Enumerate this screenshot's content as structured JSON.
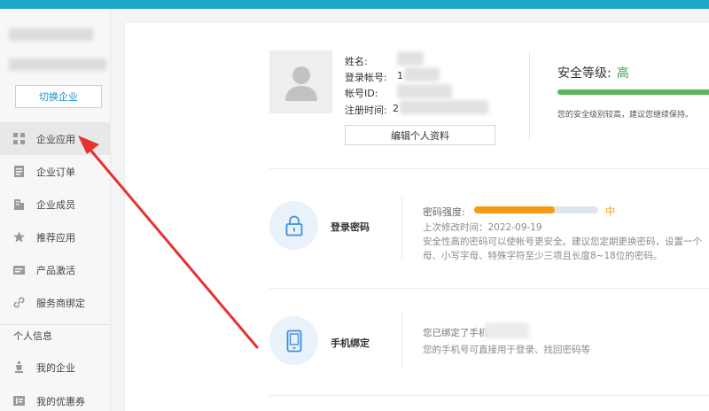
{
  "sidebar": {
    "switch_button": "切换企业",
    "items": [
      {
        "label": "企业应用",
        "icon": "apps-grid-icon",
        "active": true
      },
      {
        "label": "企业订单",
        "icon": "order-doc-icon",
        "active": false
      },
      {
        "label": "企业成员",
        "icon": "building-icon",
        "active": false
      },
      {
        "label": "推荐应用",
        "icon": "star-icon",
        "active": false
      },
      {
        "label": "产品激活",
        "icon": "card-icon",
        "active": false
      },
      {
        "label": "服务商绑定",
        "icon": "link-icon",
        "active": false
      }
    ],
    "section_header": "个人信息",
    "personal_items": [
      {
        "label": "我的企业",
        "icon": "trophy-icon"
      },
      {
        "label": "我的优惠券",
        "icon": "coupon-icon"
      }
    ]
  },
  "profile": {
    "name_label": "姓名:",
    "account_label": "登录帐号:",
    "account_id_label": "帐号ID:",
    "register_label": "注册时间:",
    "account_visible_prefix": "1",
    "register_visible_prefix": "2",
    "edit_button": "编辑个人资料"
  },
  "security": {
    "title": "安全等级:",
    "level": "高",
    "level_color": "#3aa64a",
    "note": "您的安全级别较高，建议您继续保持。"
  },
  "password": {
    "title": "登录密码",
    "strength_label": "密码强度:",
    "strength_level": "中",
    "strength_fraction": 0.65,
    "strength_color": "#f59b17",
    "last_modified": "上次修改时间：2022-09-19",
    "tip_line1": "安全性高的密码可以使帐号更安全。建议您定期更换密码，设置一个",
    "tip_line2": "母、小写字母、特殊字符至少三项且长度8~18位的密码。"
  },
  "phone": {
    "title": "手机绑定",
    "bound_text": "您已绑定了手机",
    "description": "您的手机号可直接用于登录、找回密码等"
  },
  "colors": {
    "topbar": "#1fa7c9",
    "accent_link": "#1b8fc4",
    "annotation_arrow": "#e8312e"
  }
}
